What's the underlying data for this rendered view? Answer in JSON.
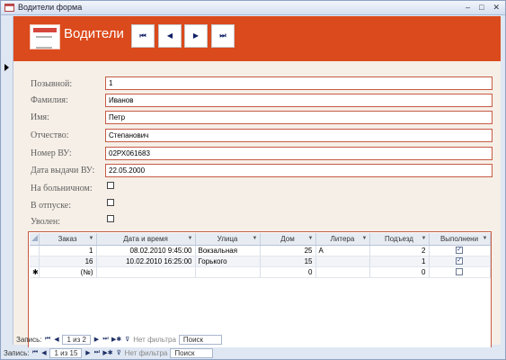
{
  "window": {
    "title": "Водители форма",
    "minimize": "–",
    "maximize": "□",
    "close": "✕"
  },
  "header": {
    "title": "Водители",
    "nav": {
      "first": "⏮",
      "prev": "◀",
      "next": "▶",
      "last": "⏭"
    }
  },
  "fields": [
    {
      "label": "Позывной:",
      "value": "1"
    },
    {
      "label": "Фамилия:",
      "value": "Иванов"
    },
    {
      "label": "Имя:",
      "value": "Петр"
    },
    {
      "label": "Отчество:",
      "value": "Степанович"
    },
    {
      "label": "Номер ВУ:",
      "value": "02РХ061683"
    },
    {
      "label": "Дата выдачи ВУ:",
      "value": "22.05.2000"
    }
  ],
  "checkboxes": [
    {
      "label": "На больничном:",
      "checked": false
    },
    {
      "label": "В отпуске:",
      "checked": false
    },
    {
      "label": "Уволен:",
      "checked": false
    }
  ],
  "subform": {
    "columns": [
      "Заказ",
      "Дата и время",
      "Улица",
      "Дом",
      "Литера",
      "Подъезд",
      "Выполнени"
    ],
    "rows": [
      {
        "order": "1",
        "datetime": "08.02.2010 9:45:00",
        "street": "Вокзальная",
        "house": "25",
        "litera": "А",
        "entrance": "2",
        "done": "✓"
      },
      {
        "order": "16",
        "datetime": "10.02.2010 16:25:00",
        "street": "Горького",
        "house": "15",
        "litera": "",
        "entrance": "1",
        "done": "✓"
      }
    ],
    "new_row": {
      "marker": "✱",
      "order": "(№)",
      "house": "0",
      "entrance": "0"
    },
    "nav": {
      "label": "Запись:",
      "position": "1 из 2",
      "filter": "Нет фильтра",
      "search": "Поиск"
    }
  },
  "main_nav": {
    "label": "Запись:",
    "position": "1 из 15",
    "filter": "Нет фильтра",
    "search": "Поиск"
  },
  "icons": {
    "first": "⏮",
    "prev": "◀",
    "next": "▶",
    "last": "⏭",
    "new": "▶✱",
    "filter": "⊽"
  },
  "colors": {
    "header": "#db4a1c",
    "detail_bg": "#f6efe7",
    "field_border": "#c55b45"
  }
}
